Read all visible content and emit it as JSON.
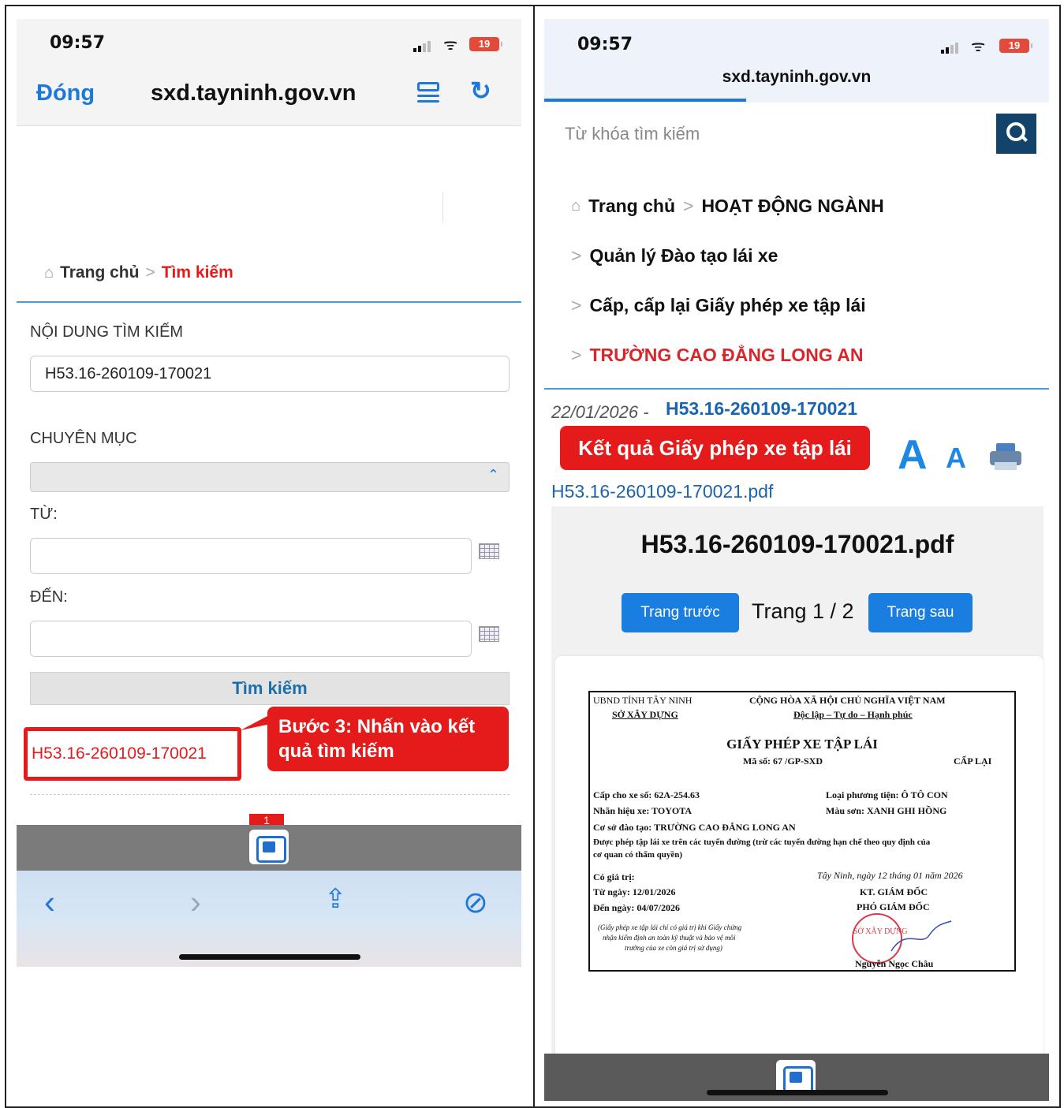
{
  "left": {
    "status": {
      "time": "09:57",
      "battery": "19"
    },
    "nav": {
      "close": "Đóng",
      "url": "sxd.tayninh.gov.vn"
    },
    "breadcrumb": {
      "home": "Trang chủ",
      "sep": ">",
      "current": "Tìm kiếm"
    },
    "form": {
      "content_label": "NỘI DUNG TÌM KIẾM",
      "content_value": "H53.16-260109-170021",
      "category_label": "CHUYÊN MỤC",
      "from_label": "TỪ:",
      "to_label": "ĐẾN:",
      "search_button": "Tìm kiếm"
    },
    "result_link": "H53.16-260109-170021",
    "callout": "Bước 3: Nhấn vào kết quả tìm kiếm",
    "page_badge": "1"
  },
  "right": {
    "status": {
      "time": "09:57",
      "battery": "19"
    },
    "url": "sxd.tayninh.gov.vn",
    "search_placeholder": "Từ khóa tìm kiếm",
    "menu": {
      "home": "Trang chủ",
      "section": "HOẠT ĐỘNG NGÀNH",
      "item1": "Quản lý Đào tạo lái xe",
      "item2": "Cấp, cấp lại Giấy phép xe tập lái",
      "item3": "TRƯỜNG CAO ĐẲNG LONG AN",
      "sep": ">"
    },
    "post": {
      "date": "22/01/2026",
      "dash": "-",
      "id": "H53.16-260109-170021",
      "label": "Kết quả Giấy phép xe tập lái",
      "font_large": "A",
      "font_small": "A",
      "attachment": "H53.16-260109-170021.pdf"
    },
    "viewer": {
      "title": "H53.16-260109-170021.pdf",
      "prev": "Trang trước",
      "page_info": "Trang 1 / 2",
      "next": "Trang sau"
    },
    "document": {
      "org1": "UBND TỈNH TÂY NINH",
      "org2": "SỞ XÂY DỰNG",
      "nation1": "CỘNG HÒA XÃ HỘI CHỦ NGHĨA VIỆT NAM",
      "nation2": "Độc lập – Tự do – Hạnh phúc",
      "title": "GIẤY PHÉP XE TẬP LÁI",
      "code": "Mã số:  67      /GP-SXD",
      "reissue": "CẤP LẠI",
      "plate": "Cấp cho xe số: 62A-254.63",
      "vehicle_type": "Loại phương tiện: Ô TÔ CON",
      "brand": "Nhãn hiệu xe: TOYOTA",
      "color": "Màu sơn: XANH GHI HỒNG",
      "facility": "Cơ sở đào tạo: TRƯỜNG CAO ĐẲNG LONG AN",
      "permit1": "Được phép tập lái xe trên các tuyến đường (trừ các tuyến đường hạn chế theo quy định của",
      "permit2": "cơ quan có thẩm quyền)",
      "valid": "Có giá trị:",
      "from": "Từ ngày: 12/01/2026",
      "to": "Đến ngày: 04/07/2026",
      "place_date": "Tây Ninh, ngày 12 tháng 01 năm 2026",
      "sign1": "KT. GIÁM ĐỐC",
      "sign2": "PHÓ GIÁM ĐỐC",
      "note1": "(Giấy phép xe tập lái chỉ có giá trị khi Giấy chứng",
      "note2": "nhận kiểm định an toàn kỹ thuật và bảo vệ môi",
      "note3": "trường của xe còn giá trị sử dụng)",
      "stamp": "SỞ XÂY DỰNG",
      "signer": "Nguyễn Ngọc Châu"
    }
  }
}
